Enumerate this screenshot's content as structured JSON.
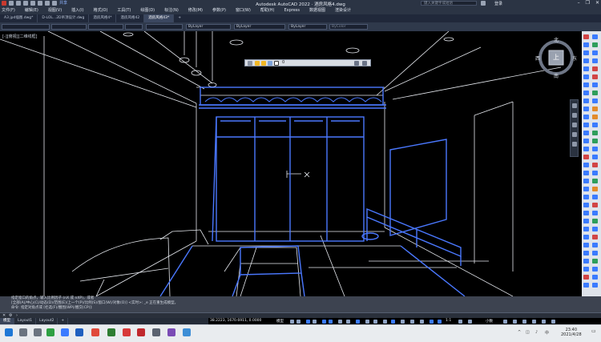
{
  "title_bar": {
    "app_title": "Autodesk AutoCAD 2022 · 酒房风格4.dwg",
    "share_label": "共享",
    "search_placeholder": "键入关键字或短语",
    "user_label": "登录"
  },
  "menu": [
    "文件(F)",
    "编辑(E)",
    "视图(V)",
    "插入(I)",
    "格式(O)",
    "工具(T)",
    "绘图(D)",
    "标注(N)",
    "修改(M)",
    "参数(P)",
    "窗口(W)",
    "帮助(H)",
    "Express",
    "数据视图",
    "渲染设计"
  ],
  "tabs": [
    {
      "label": "A3 jpd插图.dwg*",
      "active": false
    },
    {
      "label": "D-LOL...2D吊顶设计.dwg",
      "active": false
    },
    {
      "label": "酒房风格4*",
      "active": false
    },
    {
      "label": "酒房风格42",
      "active": false
    },
    {
      "label": "酒房风格43*",
      "active": true
    }
  ],
  "properties": {
    "color": "ByLayer",
    "linetype": "ByLayer",
    "lineweight": "ByLayer",
    "plot_style": "ByColor"
  },
  "viewport_label": "[-][俯视][二维线框]",
  "layer_toolbar": {
    "current_layer": "0"
  },
  "viewcube": {
    "north": "北",
    "south": "南",
    "east": "东",
    "west": "西",
    "face": "上"
  },
  "command": {
    "history": [
      "指定窗口的角点，输入比例因子 (nX 或 nXP)，或者",
      "[全部(A)/中心(C)/动态(D)/范围(E)/上一个(P)/比例(S)/窗口(W)/对象(O)] <实时>: _e 正在重生成模型。",
      "命令: 指定对角点或 [栏选(F)/圈围(WP)/圈交(CP)]:"
    ],
    "input": ""
  },
  "layouts": [
    {
      "label": "模型",
      "active": true
    },
    {
      "label": "Layout1",
      "active": false
    },
    {
      "label": "Layout2",
      "active": false
    }
  ],
  "status": {
    "coords": "38.2223, 1670.6911, 0.0000",
    "mode": "模型",
    "scale": "1:1",
    "units": "小数"
  },
  "clock": {
    "time": "23:40",
    "date": "2021/4/28"
  },
  "colors": {
    "accent": "#3b7bff",
    "drawing_line": "#e6e9ef",
    "highlight_line": "#4a78ff",
    "toolbar_bg": "#2f394b"
  }
}
